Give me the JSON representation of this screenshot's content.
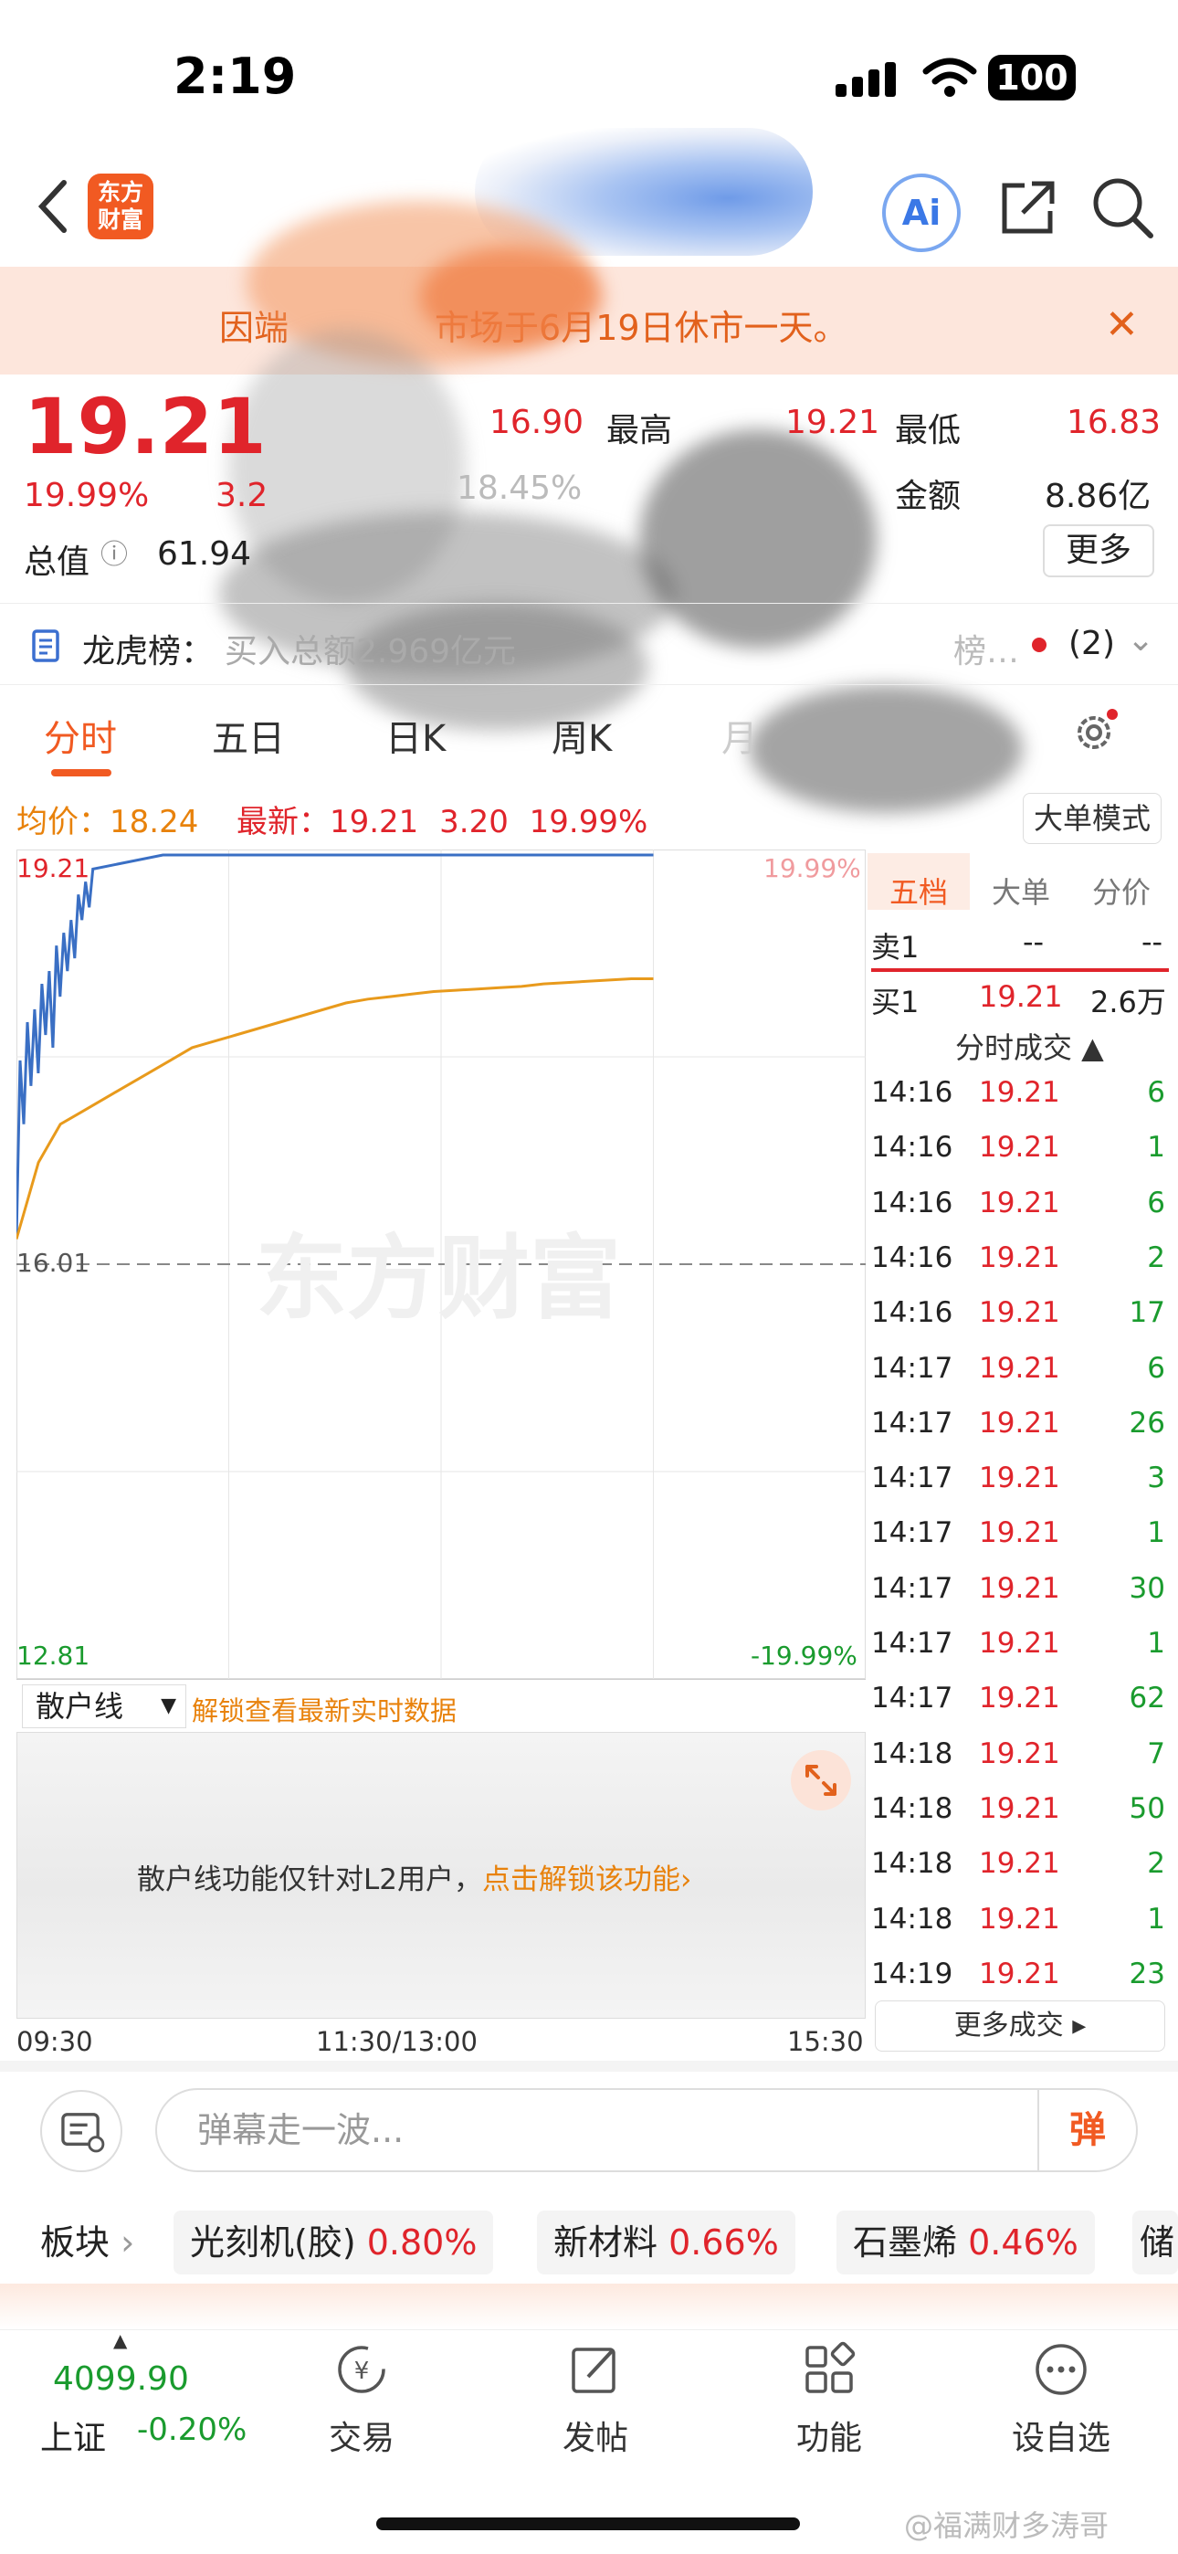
{
  "status_bar": {
    "time": "2:19",
    "battery": "100"
  },
  "header": {
    "logo_text": "东方\n财富"
  },
  "banner": {
    "text_left": "因端",
    "text_right": "市场于6月19日休市一天。"
  },
  "quote": {
    "price": "19.21",
    "change_pct": "19.99%",
    "change_amt": "3.2",
    "open": "16.90",
    "high_label": "最高",
    "high": "19.21",
    "low_label": "最低",
    "low": "16.83",
    "turnover_pct": "18.45%",
    "amount_label": "金额",
    "amount": "8.86亿",
    "mktcap_label": "总值",
    "mktcap": "61.94",
    "more": "更多"
  },
  "longhu": {
    "label": "龙虎榜：",
    "text": "买入总额2.969亿元",
    "right_text": "榜…",
    "count": "(2)"
  },
  "tabs": [
    "分时",
    "五日",
    "日K",
    "周K",
    "月"
  ],
  "info": {
    "avg_label": "均价：",
    "avg": "18.24",
    "latest_label": "最新：",
    "latest": "19.21",
    "chg": "3.20",
    "pct": "19.99%",
    "bigorder": "大单模式"
  },
  "chart_data": {
    "type": "line",
    "title": "",
    "yaxis": {
      "top": "19.21",
      "mid": "16.01",
      "bottom": "12.81"
    },
    "pct_axis": {
      "top": "19.99%",
      "bottom": "-19.99%"
    },
    "xaxis": [
      "09:30",
      "11:30/13:00",
      "15:30"
    ],
    "ylim": [
      12.81,
      19.21
    ],
    "series": [
      {
        "values": [
          16.2,
          17.6,
          17.1,
          17.9,
          17.4,
          18.0,
          17.5,
          18.2,
          17.8,
          18.3,
          17.7,
          18.5,
          18.1,
          18.6,
          18.3,
          18.7,
          18.4,
          18.9,
          18.7,
          19.0,
          18.8,
          19.1,
          19.21,
          19.21,
          19.21,
          19.21,
          19.21,
          19.21,
          19.21,
          19.21
        ],
        "color": "#3a6fc4"
      },
      {
        "values": [
          16.2,
          16.8,
          17.1,
          17.2,
          17.3,
          17.4,
          17.5,
          17.6,
          17.7,
          17.75,
          17.8,
          17.85,
          17.9,
          17.95,
          18.0,
          18.05,
          18.08,
          18.1,
          18.12,
          18.14,
          18.15,
          18.16,
          18.17,
          18.18,
          18.2,
          18.21,
          18.22,
          18.23,
          18.24,
          18.24
        ],
        "color": "#e89a1c"
      }
    ]
  },
  "watermark": "东方财富",
  "right_panel": {
    "tabs": [
      "五档",
      "大单",
      "分价"
    ],
    "sell1_label": "卖1",
    "sell1_price": "--",
    "sell1_vol": "--",
    "buy1_label": "买1",
    "buy1_price": "19.21",
    "buy1_vol": "2.6万",
    "trades_header": "分时成交 ▲",
    "trades": [
      {
        "t": "14:16",
        "p": "19.21",
        "v": "6"
      },
      {
        "t": "14:16",
        "p": "19.21",
        "v": "1"
      },
      {
        "t": "14:16",
        "p": "19.21",
        "v": "6"
      },
      {
        "t": "14:16",
        "p": "19.21",
        "v": "2"
      },
      {
        "t": "14:16",
        "p": "19.21",
        "v": "17"
      },
      {
        "t": "14:17",
        "p": "19.21",
        "v": "6"
      },
      {
        "t": "14:17",
        "p": "19.21",
        "v": "26"
      },
      {
        "t": "14:17",
        "p": "19.21",
        "v": "3"
      },
      {
        "t": "14:17",
        "p": "19.21",
        "v": "1"
      },
      {
        "t": "14:17",
        "p": "19.21",
        "v": "30"
      },
      {
        "t": "14:17",
        "p": "19.21",
        "v": "1"
      },
      {
        "t": "14:17",
        "p": "19.21",
        "v": "62"
      },
      {
        "t": "14:18",
        "p": "19.21",
        "v": "7"
      },
      {
        "t": "14:18",
        "p": "19.21",
        "v": "50"
      },
      {
        "t": "14:18",
        "p": "19.21",
        "v": "2"
      },
      {
        "t": "14:18",
        "p": "19.21",
        "v": "1"
      },
      {
        "t": "14:19",
        "p": "19.21",
        "v": "23"
      }
    ],
    "more_trades": "更多成交 ▸"
  },
  "indicator": {
    "select": "散户线",
    "unlock": "解锁查看最新实时数据",
    "msg": "散户线功能仅针对L2用户，",
    "msg_link": "点击解锁该功能›"
  },
  "danmu": {
    "placeholder": "弹幕走一波...",
    "button": "弹"
  },
  "sectors": {
    "label": "板块",
    "items": [
      {
        "name": "光刻机(胶)",
        "pct": "0.80%"
      },
      {
        "name": "新材料",
        "pct": "0.66%"
      },
      {
        "name": "石墨烯",
        "pct": "0.46%"
      }
    ],
    "cut": "储"
  },
  "bottom_nav": {
    "index_value": "4099.90",
    "index_name": "上证",
    "index_pct": "-0.20%",
    "items": [
      "交易",
      "发帖",
      "功能",
      "设自选"
    ]
  },
  "watermark_weibo": "@福满财多涛哥"
}
